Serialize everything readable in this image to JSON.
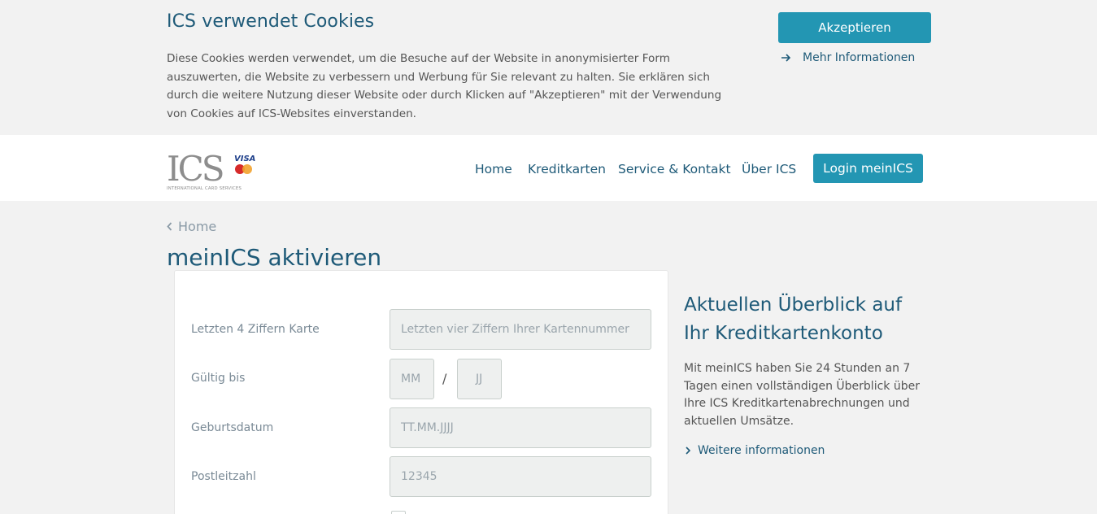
{
  "cookie_banner": {
    "title": "ICS verwendet Cookies",
    "text": "Diese Cookies werden verwendet, um die Besuche auf der Website in anonymisierter Form auszuwerten, die Website zu verbessern und Werbung für Sie relevant zu halten. Sie erklären sich durch die weitere Nutzung dieser Website oder durch Klicken auf \"Akzeptieren\" mit der Verwendung von Cookies auf ICS-Websites einverstanden.",
    "accept_label": "Akzeptieren",
    "more_info_label": "Mehr Informationen",
    "more_info_icon": "arrow-right-icon"
  },
  "header": {
    "logo_text": "ICS",
    "logo_sub": "INTERNATIONAL CARD SERVICES",
    "logo_visa": "VISA",
    "nav": {
      "home": "Home",
      "kreditkarten": "Kreditkarten",
      "service": "Service & Kontakt",
      "ueber": "Über ICS"
    },
    "login_label": "Login meinICS"
  },
  "breadcrumb": {
    "label": "Home",
    "icon": "chevron-left-icon"
  },
  "page_title": "meinICS aktivieren",
  "form": {
    "card_label": "Letzten 4 Ziffern Karte",
    "card_placeholder": "Letzten vier Ziffern Ihrer Kartennummer",
    "valid_label": "Gültig bis",
    "month_placeholder": "MM",
    "separator": "/",
    "year_placeholder": "JJ",
    "birth_label": "Geburtsdatum",
    "birth_placeholder": "TT.MM.JJJJ",
    "zip_label": "Postleitzahl",
    "zip_placeholder": "12345"
  },
  "side": {
    "title": "Aktuellen Überblick auf Ihr Kreditkartenkonto",
    "text": "Mit meinICS haben Sie 24 Stunden an 7 Tagen einen vollständigen Überblick über Ihre ICS Kreditkartenabrechnungen und aktuellen Umsätze.",
    "link_label": "Weitere informationen",
    "link_icon": "chevron-right-icon"
  },
  "colors": {
    "primary": "#2396b3",
    "heading": "#1e5a78",
    "background": "#f2f2f2"
  }
}
